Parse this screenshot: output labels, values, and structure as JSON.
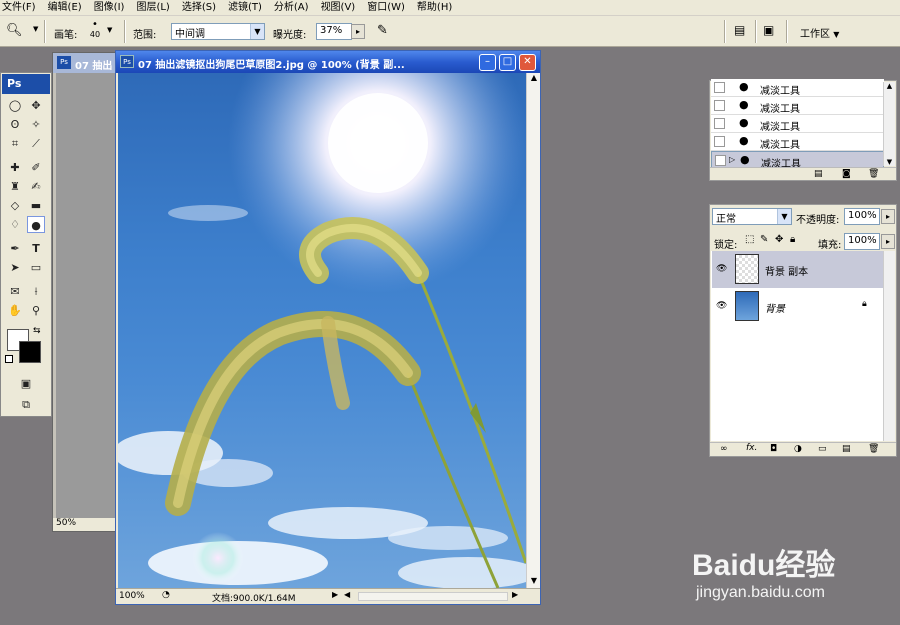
{
  "menu": [
    "文件(F)",
    "编辑(E)",
    "图像(I)",
    "图层(L)",
    "选择(S)",
    "滤镜(T)",
    "分析(A)",
    "视图(V)",
    "窗口(W)",
    "帮助(H)"
  ],
  "options": {
    "brush_label": "画笔:",
    "brush_size": "40",
    "range_label": "范围:",
    "range_value": "中间调",
    "exposure_label": "曝光度:",
    "exposure_value": "37%",
    "workspace_label": "工作区"
  },
  "toolbox": {
    "logo": "Ps"
  },
  "back_doc": {
    "title": "07 抽出",
    "zoom": "50%"
  },
  "main_doc": {
    "title": "07 抽出滤镜抠出狗尾巴草原图2.jpg @ 100% (背景 副...",
    "zoom": "100%",
    "doc_info": "文档:900.0K/1.64M"
  },
  "history": {
    "items": [
      "减淡工具",
      "减淡工具",
      "减淡工具",
      "减淡工具",
      "减淡工具"
    ]
  },
  "layers": {
    "blend_mode": "正常",
    "opacity_label": "不透明度:",
    "opacity_value": "100%",
    "lock_label": "锁定:",
    "fill_label": "填充:",
    "fill_value": "100%",
    "items": [
      {
        "name": "背景 副本",
        "selected": true
      },
      {
        "name": "背景",
        "selected": false
      }
    ]
  },
  "watermark": {
    "brand": "Baidu经验",
    "url": "jingyan.baidu.com"
  },
  "colors": {
    "accent": "#2a5ccf",
    "panel_bg": "#ece9d8",
    "workspace_bg": "#7b787b"
  }
}
